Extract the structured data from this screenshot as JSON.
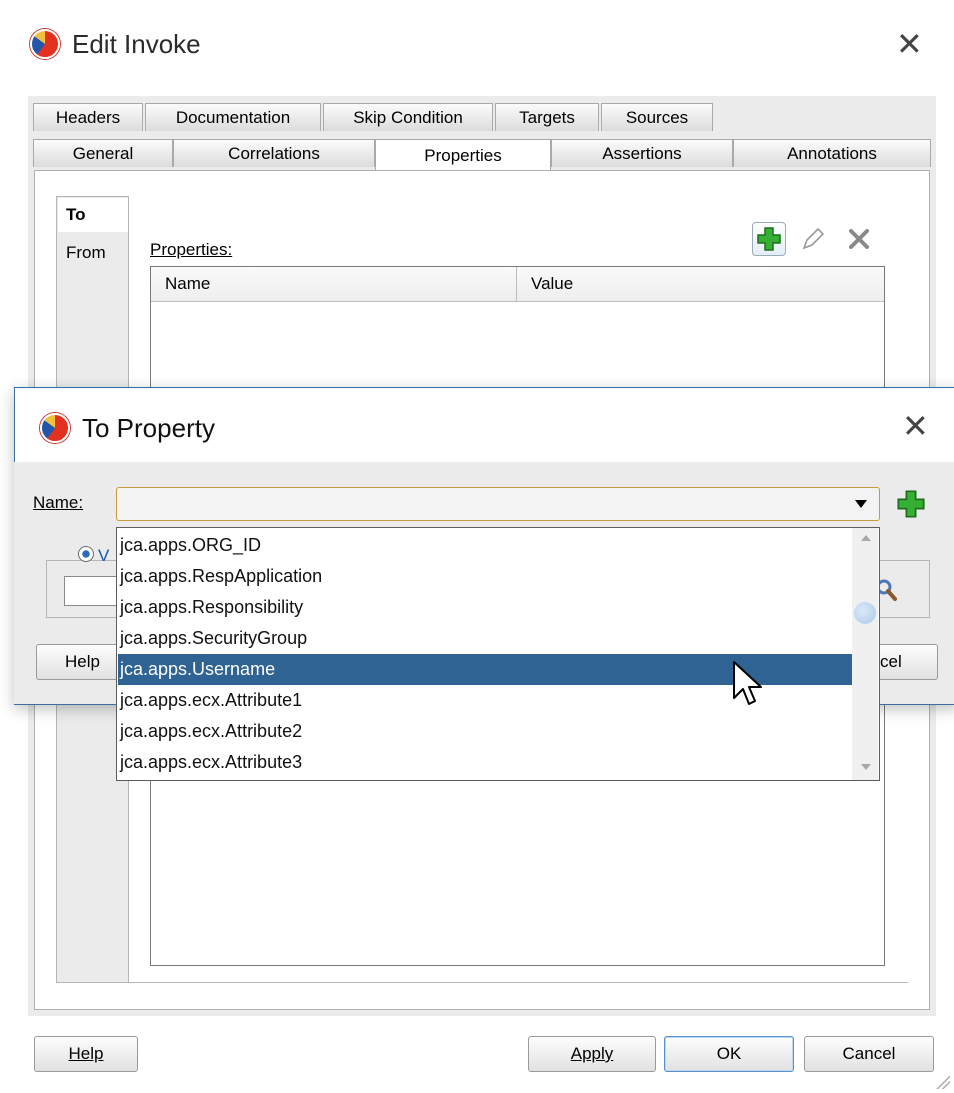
{
  "main_window": {
    "title": "Edit Invoke",
    "tabs_row1": [
      "Headers",
      "Documentation",
      "Skip Condition",
      "Targets",
      "Sources"
    ],
    "tabs_row2": [
      "General",
      "Correlations",
      "Properties",
      "Assertions",
      "Annotations"
    ],
    "active_tab": "Properties",
    "side_tabs": {
      "to": "To",
      "from": "From"
    },
    "properties_label": "Properties:",
    "grid_headers": {
      "name": "Name",
      "value": "Value"
    },
    "buttons": {
      "help": "Help",
      "apply": "Apply",
      "ok": "OK",
      "cancel": "Cancel"
    }
  },
  "dialog": {
    "title": "To Property",
    "name_label": "Name:",
    "name_value": "",
    "obscured": {
      "radio_fragment": "V",
      "help_fragment": "Help",
      "cancel_fragment": "cel"
    }
  },
  "dropdown": {
    "items": [
      "jca.apps.ORG_ID",
      "jca.apps.RespApplication",
      "jca.apps.Responsibility",
      "jca.apps.SecurityGroup",
      "jca.apps.Username",
      "jca.apps.ecx.Attribute1",
      "jca.apps.ecx.Attribute2",
      "jca.apps.ecx.Attribute3"
    ],
    "selected": "jca.apps.Username"
  },
  "colors": {
    "selection": "#2f6394",
    "add_green": "#2ea32e",
    "accent_border": "#3a6ea5"
  },
  "icons": {
    "app": "oracle-logo-icon",
    "add": "plus-icon",
    "edit": "pencil-icon",
    "delete": "x-icon",
    "close": "close-icon"
  }
}
